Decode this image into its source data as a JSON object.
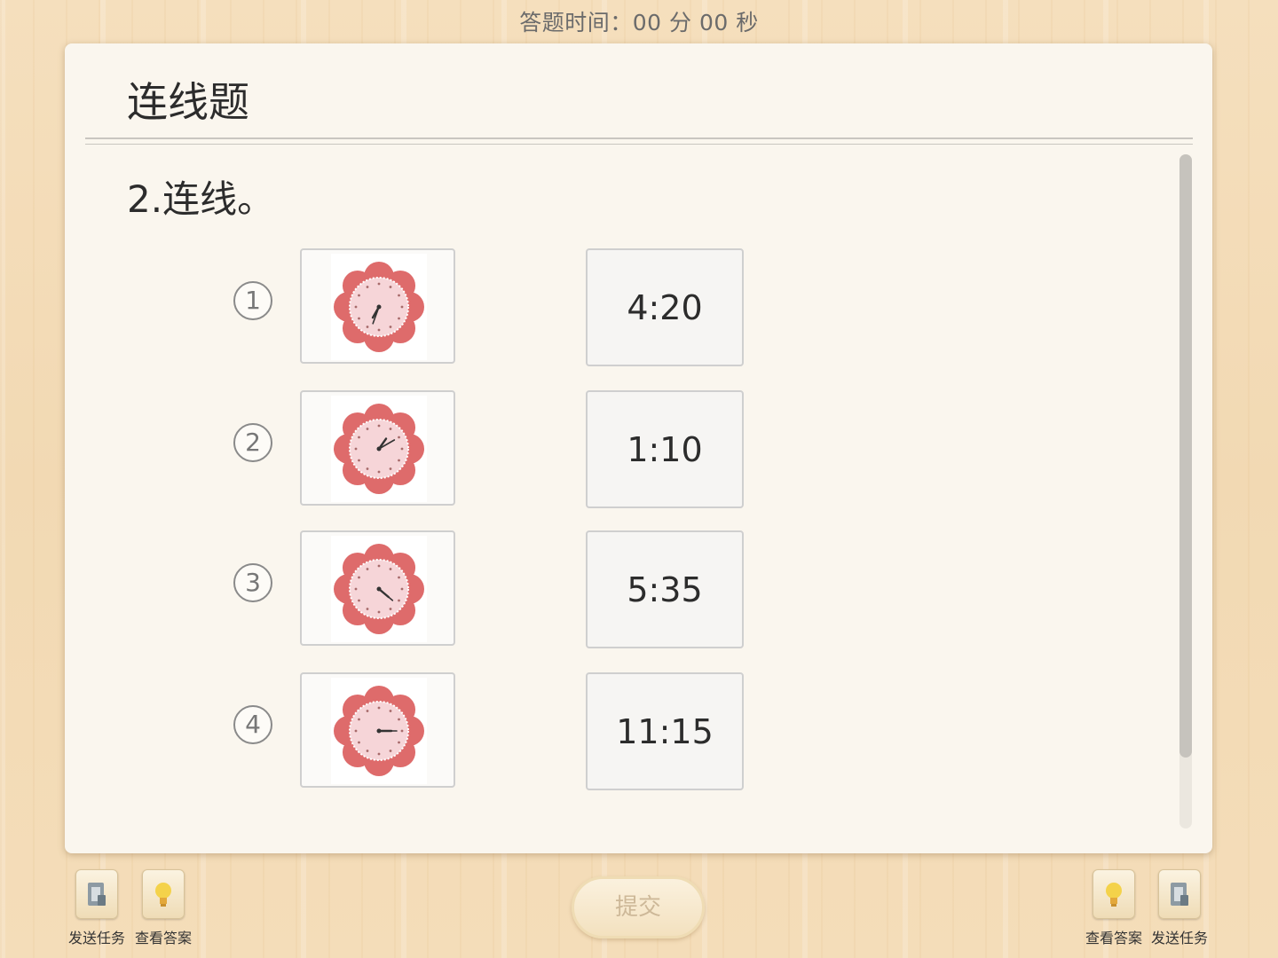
{
  "header": {
    "timer_label": "答题时间：00 分 00 秒"
  },
  "card": {
    "title": "连线题",
    "question": "2.连线。"
  },
  "matching": {
    "items": [
      {
        "number": "1",
        "clock_hour_angle": 210,
        "clock_minute_angle": 200
      },
      {
        "number": "2",
        "clock_hour_angle": 35,
        "clock_minute_angle": 60
      },
      {
        "number": "3",
        "clock_hour_angle": 130,
        "clock_minute_angle": 130
      },
      {
        "number": "4",
        "clock_hour_angle": 90,
        "clock_minute_angle": 90
      }
    ],
    "times": [
      "4:20",
      "1:10",
      "5:35",
      "11:15"
    ]
  },
  "toolbar": {
    "left_send_label": "发送任务",
    "left_answer_label": "查看答案",
    "submit_label": "提交",
    "right_answer_label": "查看答案",
    "right_send_label": "发送任务"
  },
  "icons": {
    "send": "send-task-icon",
    "answer": "lightbulb-icon",
    "clock": "clock-icon"
  },
  "colors": {
    "flower": "#de6b6b",
    "clock_face": "#f6d5d8",
    "background": "#f3dcb8"
  }
}
